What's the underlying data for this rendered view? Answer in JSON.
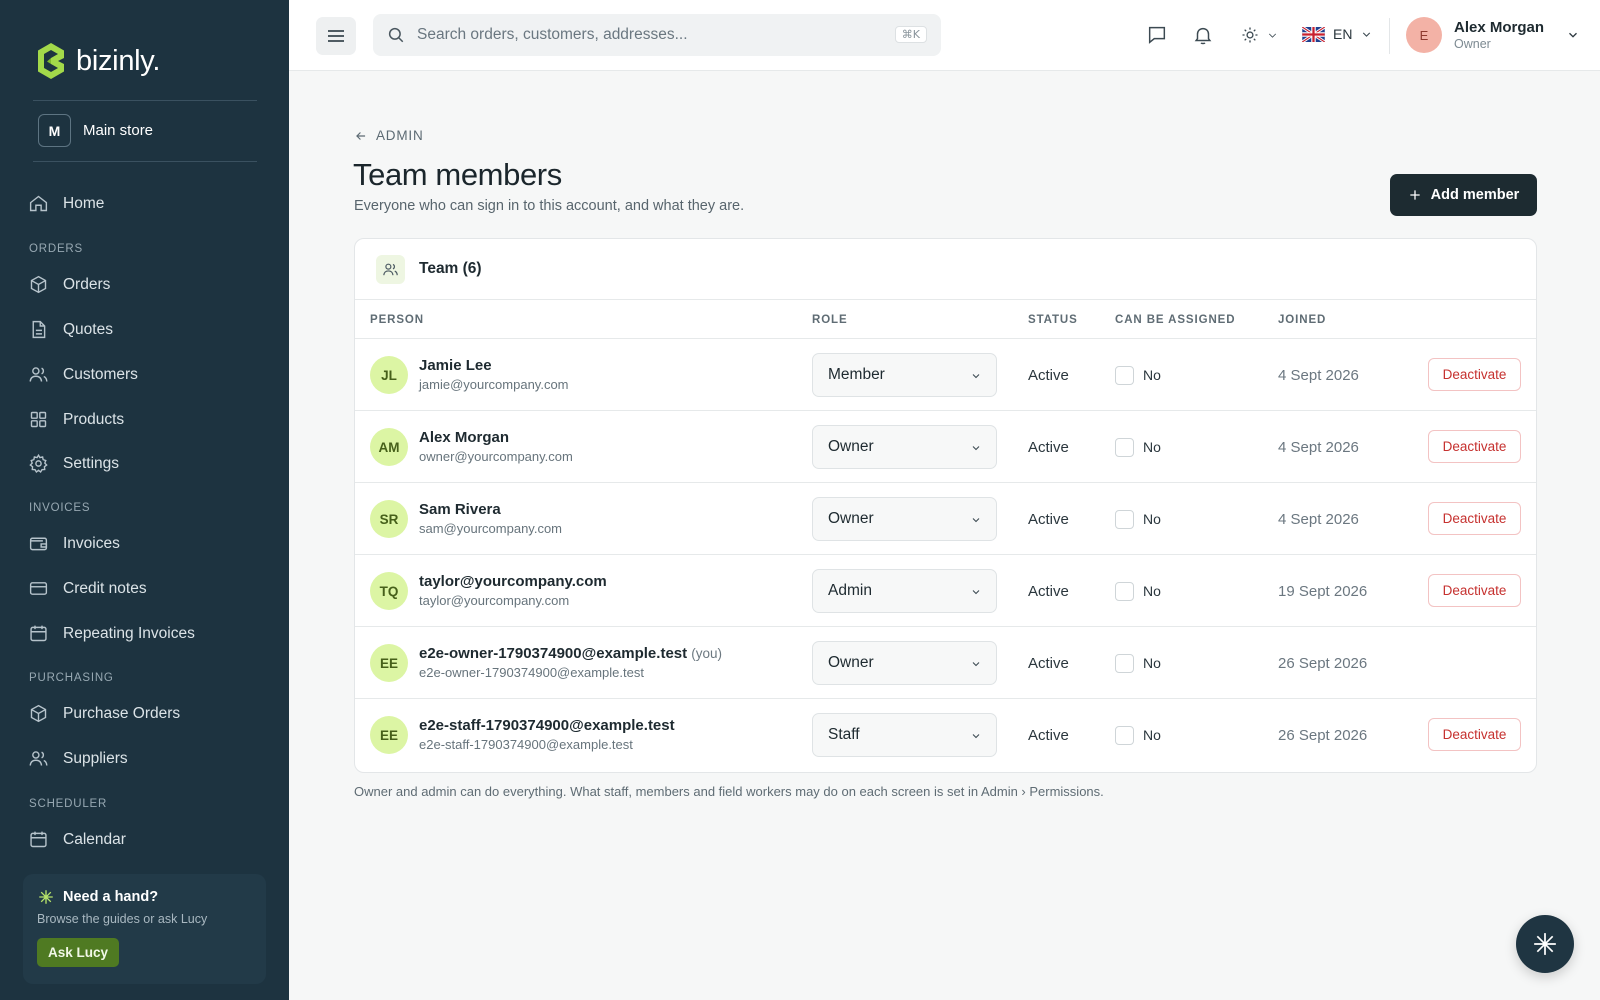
{
  "sidebar": {
    "brand": "bizinly.",
    "store": {
      "badge": "M",
      "label": "Main store"
    },
    "home": "Home",
    "sections": {
      "orders": "ORDERS",
      "invoices": "INVOICES",
      "purchasing": "PURCHASING",
      "scheduler": "SCHEDULER"
    },
    "items": {
      "orders": "Orders",
      "quotes": "Quotes",
      "customers": "Customers",
      "products": "Products",
      "settings": "Settings",
      "invoices": "Invoices",
      "credit_notes": "Credit notes",
      "repeating_invoices": "Repeating Invoices",
      "purchase_orders": "Purchase Orders",
      "suppliers": "Suppliers",
      "calendar": "Calendar"
    },
    "help": {
      "title": "Need a hand?",
      "subtitle": "Browse the guides or ask Lucy",
      "button": "Ask Lucy"
    }
  },
  "topbar": {
    "search_placeholder": "Search orders, customers, addresses...",
    "shortcut": "⌘K",
    "language": "EN",
    "user": {
      "initial": "E",
      "name": "Alex Morgan",
      "role": "Owner"
    }
  },
  "page": {
    "breadcrumb": "ADMIN",
    "title": "Team members",
    "subtitle": "Everyone who can sign in to this account, and what they are.",
    "add_button": "Add member",
    "card_title": "Team (6)",
    "columns": {
      "person": "PERSON",
      "role": "ROLE",
      "status": "STATUS",
      "assignable": "CAN BE ASSIGNED",
      "joined": "JOINED"
    },
    "members": [
      {
        "initials": "JL",
        "name": "Jamie Lee",
        "you": "",
        "email": "jamie@yourcompany.com",
        "role": "Member",
        "status": "Active",
        "assignable": "No",
        "joined": "4 Sept 2026",
        "action": "Deactivate"
      },
      {
        "initials": "AM",
        "name": "Alex Morgan",
        "you": "",
        "email": "owner@yourcompany.com",
        "role": "Owner",
        "status": "Active",
        "assignable": "No",
        "joined": "4 Sept 2026",
        "action": "Deactivate"
      },
      {
        "initials": "SR",
        "name": "Sam Rivera",
        "you": "",
        "email": "sam@yourcompany.com",
        "role": "Owner",
        "status": "Active",
        "assignable": "No",
        "joined": "4 Sept 2026",
        "action": "Deactivate"
      },
      {
        "initials": "TQ",
        "name": "taylor@yourcompany.com",
        "you": "",
        "email": "taylor@yourcompany.com",
        "role": "Admin",
        "status": "Active",
        "assignable": "No",
        "joined": "19 Sept 2026",
        "action": "Deactivate"
      },
      {
        "initials": "EE",
        "name": "e2e-owner-1790374900@example.test",
        "you": "(you)",
        "email": "e2e-owner-1790374900@example.test",
        "role": "Owner",
        "status": "Active",
        "assignable": "No",
        "joined": "26 Sept 2026",
        "action": ""
      },
      {
        "initials": "EE",
        "name": "e2e-staff-1790374900@example.test",
        "you": "",
        "email": "e2e-staff-1790374900@example.test",
        "role": "Staff",
        "status": "Active",
        "assignable": "No",
        "joined": "26 Sept 2026",
        "action": "Deactivate"
      }
    ],
    "footnote": "Owner and admin can do everything. What staff, members and field workers may do on each screen is set in Admin › Permissions."
  },
  "colors": {
    "sidebar_bg": "#1d3340",
    "primary_button": "#1d2b31",
    "avatar_bg": "#dcf5a4",
    "danger": "#c6312f",
    "accent_green": "#4f7a22"
  }
}
